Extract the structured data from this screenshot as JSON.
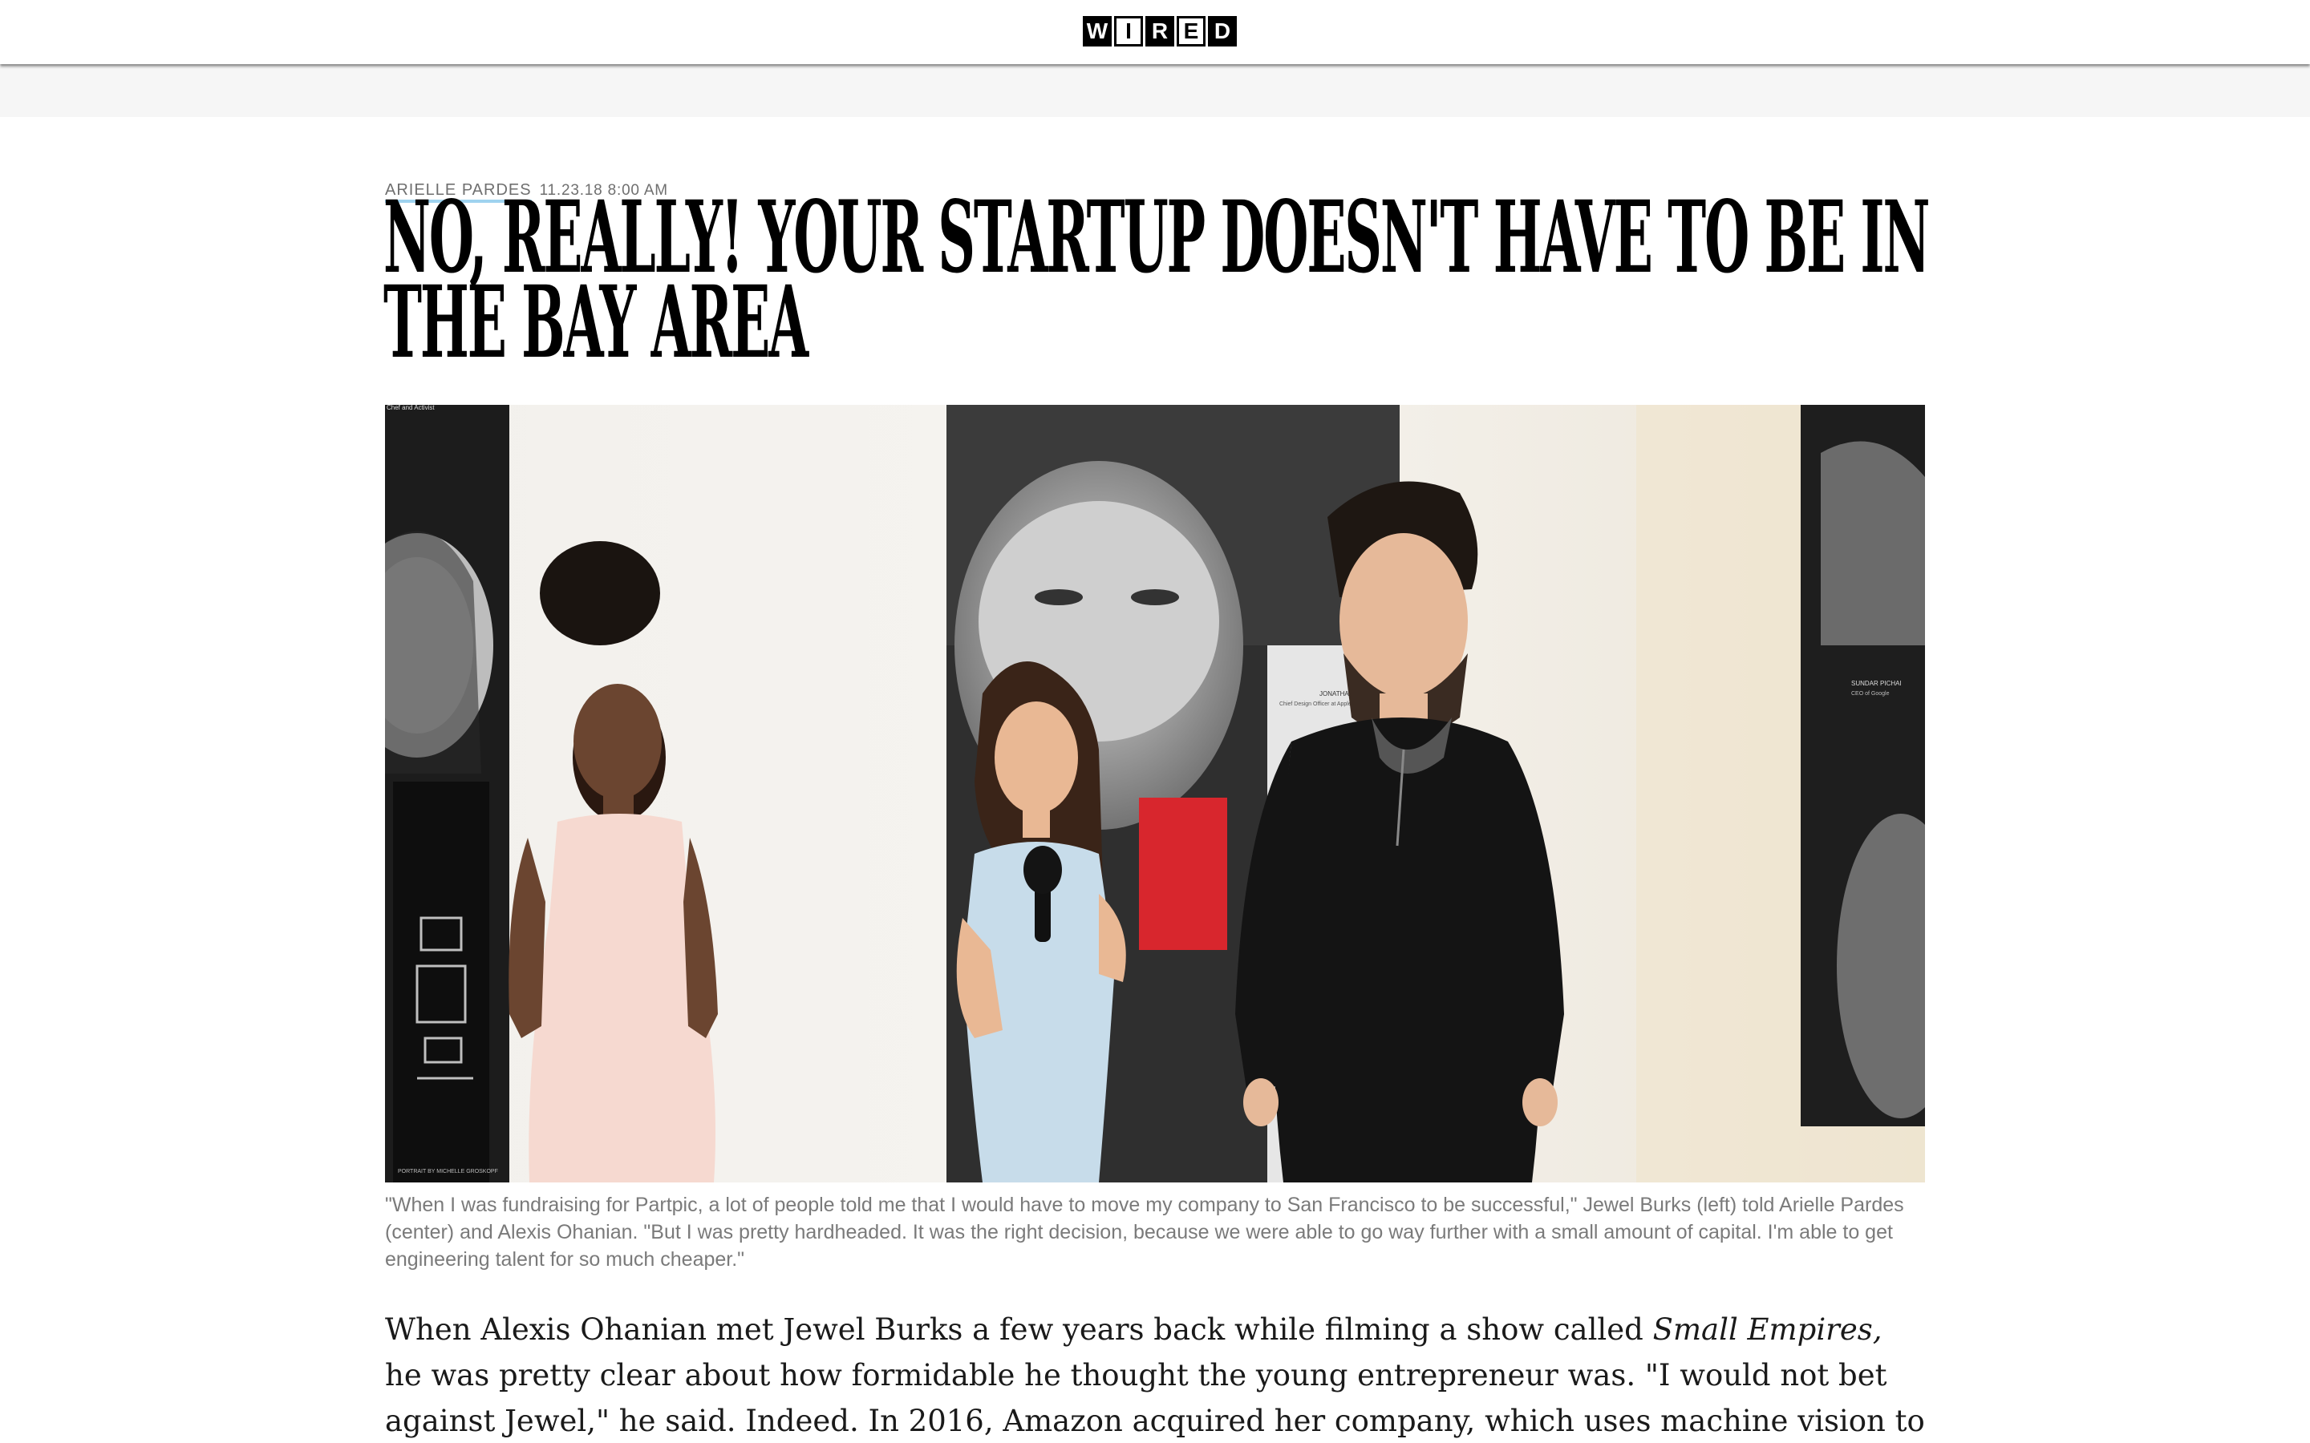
{
  "header": {
    "logo_letters": [
      "W",
      "I",
      "R",
      "E",
      "D"
    ]
  },
  "article": {
    "author": "ARIELLE PARDES",
    "date": "11.23.18 8:00 AM",
    "headline": "NO, REALLY! YOUR STARTUP DOESN'T HAVE TO BE IN THE BAY AREA",
    "headline_lines": [
      "NO, REALLY! YOUR STARTUP DOESN'T HAVE TO BE IN",
      "THE BAY AREA"
    ],
    "caption": "\"When I was fundraising for Partpic, a lot of people told me that I would have to move my company to San Francisco to be successful,\" Jewel Burks (left) told Arielle Pardes (center) and Alexis Ohanian. \"But I was pretty hardheaded. It was the right decision, because we were able to go way further with a small amount of capital. I'm able to get engineering talent for so much cheaper.\"",
    "body": {
      "before_em": "When Alexis Ohanian met Jewel Burks a few years back while filming a show called ",
      "em": "Small Empires,",
      "after_em": " he was pretty clear about how formidable he thought the young entrepreneur was. \"I would not bet against Jewel,\" he said. Indeed. In 2016, Amazon acquired her company, which uses machine vision to identify the weird"
    }
  },
  "photo": {
    "poster_center_name": "JONATHAN IVE",
    "poster_center_title": "Chief Design Officer at Apple",
    "poster_right_name": "SUNDAR PICHAI",
    "poster_right_title": "CEO of Google",
    "poster_left_title": "Chef and Activist",
    "poster_credit": "PORTRAIT BY MICHELLE GROSKOPF"
  }
}
